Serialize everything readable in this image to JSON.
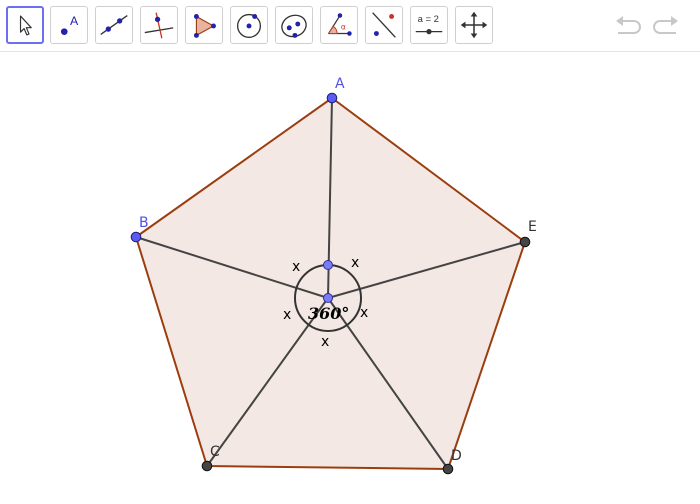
{
  "toolbar": {
    "tools": [
      {
        "name": "move-tool",
        "active": true
      },
      {
        "name": "point-tool",
        "label": "A"
      },
      {
        "name": "line-tool"
      },
      {
        "name": "perpendicular-line-tool"
      },
      {
        "name": "polygon-tool"
      },
      {
        "name": "circle-center-point-tool"
      },
      {
        "name": "conic-tool"
      },
      {
        "name": "angle-tool",
        "label": "α"
      },
      {
        "name": "reflect-about-line-tool"
      },
      {
        "name": "slider-tool",
        "label": "a = 2"
      },
      {
        "name": "move-graphics-view-tool"
      }
    ],
    "undo_icon": "undo-icon",
    "redo_icon": "redo-icon"
  },
  "colors": {
    "accent": "#6d6ef2",
    "polygon_fill": "#f4e8e4",
    "polygon_edge": "#9b3e0f",
    "segment": "#444444",
    "point_free": "#5b5bf0",
    "point_dependent": "#444444",
    "label_free": "#5050e8",
    "label_dependent": "#333333"
  },
  "geometry": {
    "points": [
      {
        "name": "A",
        "label": "A",
        "kind": "free"
      },
      {
        "name": "B",
        "label": "B",
        "kind": "free"
      },
      {
        "name": "C",
        "label": "C",
        "kind": "dependent"
      },
      {
        "name": "D",
        "label": "D",
        "kind": "dependent"
      },
      {
        "name": "E",
        "label": "E",
        "kind": "dependent"
      }
    ],
    "angle_labels": [
      "x",
      "x",
      "x",
      "x",
      "x"
    ],
    "full_angle_label": "360°"
  }
}
